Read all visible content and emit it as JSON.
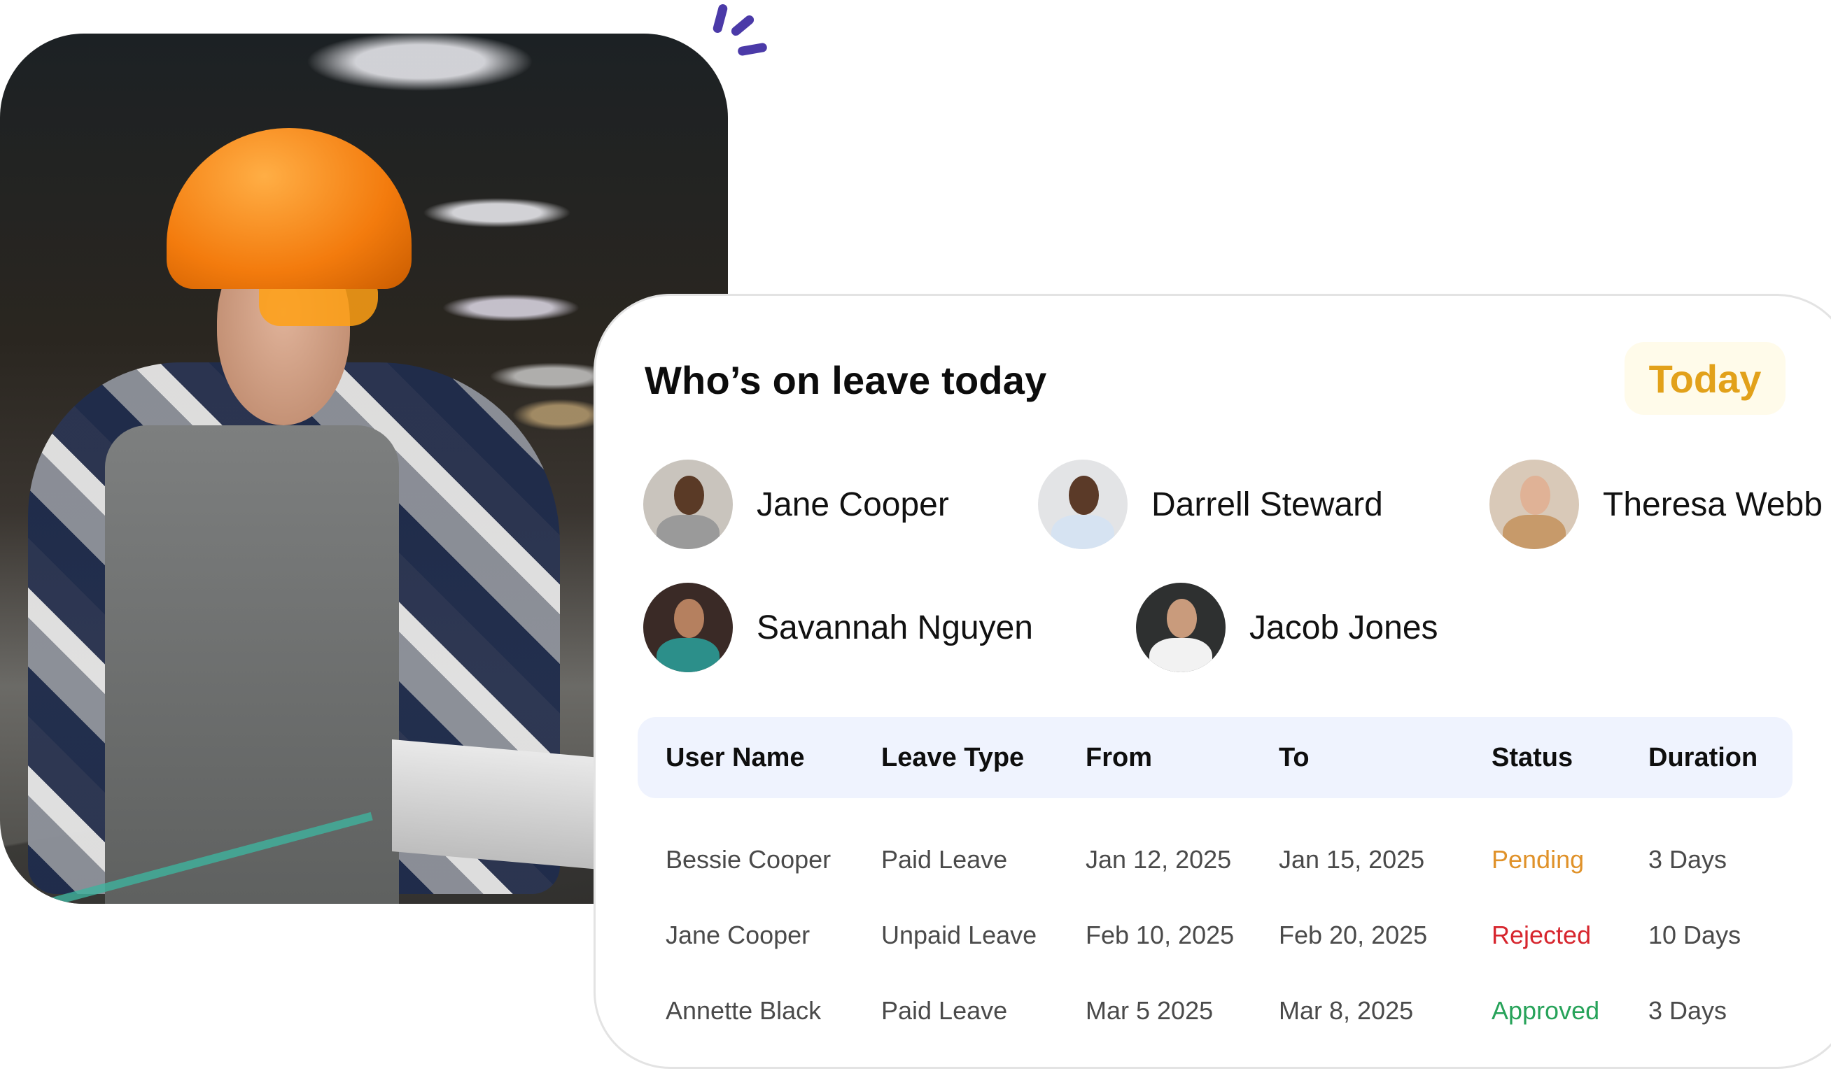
{
  "card": {
    "title": "Who’s on leave today",
    "filter_badge": {
      "label": "Today",
      "color": "#e2a11a",
      "background": "#fffbea"
    }
  },
  "on_leave": [
    {
      "name": "Jane Cooper",
      "avatar_colors": {
        "bg": "#c9c4bd",
        "face": "#5a3a26",
        "shirt": "#9a9a9a"
      }
    },
    {
      "name": "Darrell Steward",
      "avatar_colors": {
        "bg": "#e3e4e6",
        "face": "#5b3a28",
        "shirt": "#d6e3f2"
      }
    },
    {
      "name": "Theresa Webb",
      "avatar_colors": {
        "bg": "#d9c9b8",
        "face": "#e0b296",
        "shirt": "#c79a6a"
      }
    },
    {
      "name": "Savannah Nguyen",
      "avatar_colors": {
        "bg": "#3a2a26",
        "face": "#b5805f",
        "shirt": "#2c8f8a"
      }
    },
    {
      "name": "Jacob Jones",
      "avatar_colors": {
        "bg": "#2e3030",
        "face": "#c99b7c",
        "shirt": "#f2f2f2"
      }
    }
  ],
  "table": {
    "columns": [
      "User Name",
      "Leave Type",
      "From",
      "To",
      "Status",
      "Duration"
    ],
    "rows": [
      {
        "user": "Bessie Cooper",
        "type": "Paid Leave",
        "from": "Jan 12, 2025",
        "to": "Jan 15, 2025",
        "status": "Pending",
        "duration": "3 Days"
      },
      {
        "user": "Jane Cooper",
        "type": "Unpaid Leave",
        "from": "Feb 10, 2025",
        "to": "Feb 20, 2025",
        "status": "Rejected",
        "duration": "10 Days"
      },
      {
        "user": "Annette Black",
        "type": "Paid Leave",
        "from": "Mar 5 2025",
        "to": "Mar 8, 2025",
        "status": "Approved",
        "duration": "3 Days"
      }
    ],
    "status_colors": {
      "Pending": "#e0922a",
      "Rejected": "#d7262e",
      "Approved": "#27a35a"
    },
    "header_background": "#eff3fe"
  },
  "accent": {
    "sparkle": "#4b3aa8"
  }
}
